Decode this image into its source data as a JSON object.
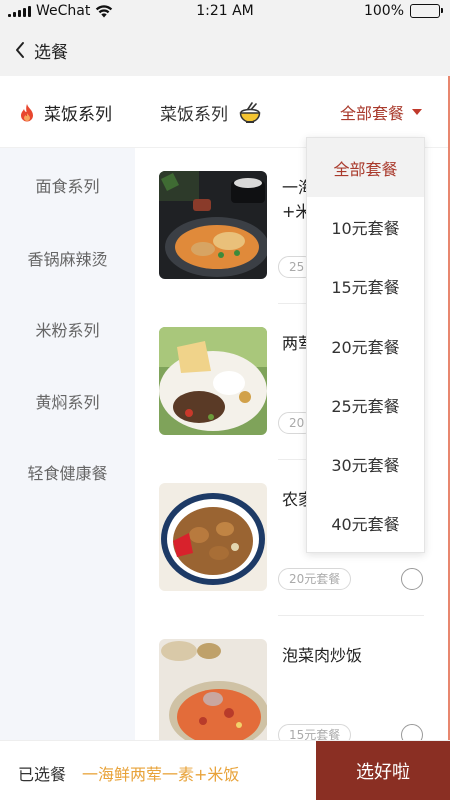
{
  "status_bar": {
    "carrier": "WeChat",
    "time": "1:21 AM",
    "battery": "100%"
  },
  "nav": {
    "title": "选餐"
  },
  "header": {
    "active_category": "菜饭系列",
    "current_category": "菜饭系列",
    "filter_label": "全部套餐"
  },
  "sidebar": {
    "items": [
      {
        "label": "面食系列"
      },
      {
        "label": "香锅麻辣烫"
      },
      {
        "label": "米粉系列"
      },
      {
        "label": "黄焖系列"
      },
      {
        "label": "轻食健康餐"
      }
    ]
  },
  "dishes": [
    {
      "name": "一海\n+米",
      "price": "25",
      "img": "curry-plate"
    },
    {
      "name": "两荤",
      "price": "20",
      "img": "rice-plate"
    },
    {
      "name": "农家",
      "price": "20元套餐",
      "img": "stew-bowl"
    },
    {
      "name": "泡菜肉炒饭",
      "price": "15元套餐",
      "img": "fried-rice"
    }
  ],
  "dropdown": {
    "options": [
      {
        "label": "全部套餐"
      },
      {
        "label": "10元套餐"
      },
      {
        "label": "15元套餐"
      },
      {
        "label": "20元套餐"
      },
      {
        "label": "25元套餐"
      },
      {
        "label": "30元套餐"
      },
      {
        "label": "40元套餐"
      }
    ],
    "selected_index": 0
  },
  "bottom": {
    "selected_label": "已选餐",
    "selected_value": "一海鲜两荤一素+米饭",
    "confirm_label": "选好啦"
  },
  "colors": {
    "accent": "#8a2f23",
    "highlight": "#e8a33a",
    "filter": "#a93a2c",
    "sidebar_bg": "#f4f6fa"
  }
}
